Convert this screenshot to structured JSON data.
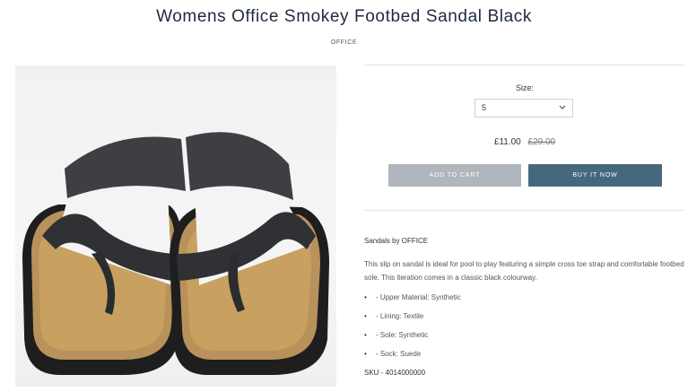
{
  "product": {
    "title": "Womens Office Smokey Footbed Sandal Black",
    "vendor": "OFFICE",
    "image_alt": "Black cross toe strap slip on sandal with cork footbed"
  },
  "options": {
    "size_label": "Size:",
    "size_value": "5"
  },
  "pricing": {
    "current": "£11.00",
    "original": "£29.00"
  },
  "actions": {
    "add_to_cart": "ADD TO CART",
    "buy_now": "BUY IT NOW"
  },
  "description": {
    "heading": "Sandals by OFFICE",
    "paragraph": "This slip on sandal is ideal for pool to play featuring a simple cross toe strap and comfortable footbed sole. This iteration comes in a classic black colourway.",
    "bullets": [
      "- Upper Material: Synthetic",
      "- Lining: Textile",
      "- Sole: Synthetic",
      "- Sock: Suede"
    ],
    "sku": "SKU - 4014000000"
  },
  "colors": {
    "title": "#1f2a3d",
    "add_to_cart_bg": "#b0b6bd",
    "buy_now_bg": "#46687d",
    "strap": "#3d3f42",
    "cork": "#c49a52"
  }
}
